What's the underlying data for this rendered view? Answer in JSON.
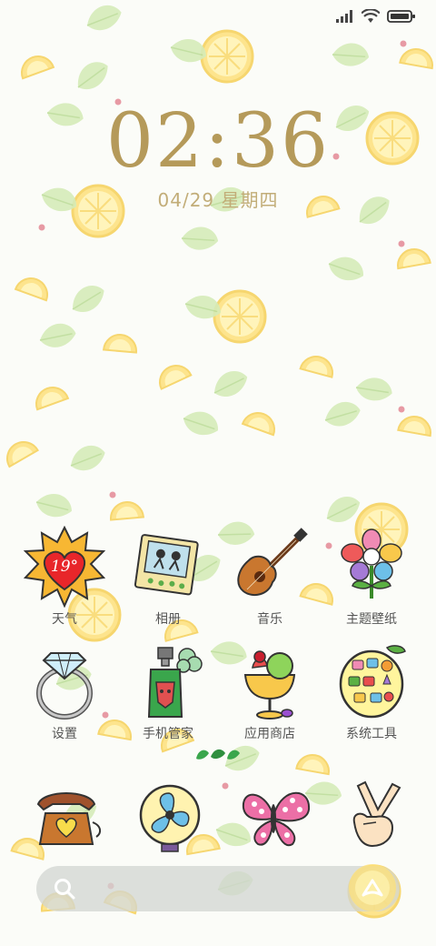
{
  "status_bar": {
    "signal_icon": "signal-bars-icon",
    "wifi_icon": "wifi-icon",
    "battery_icon": "battery-icon"
  },
  "lockscreen": {
    "time": "02:36",
    "date": "04/29 星期四"
  },
  "apps": [
    {
      "label": "天气",
      "icon": "weather-sun-icon",
      "temp": "19°"
    },
    {
      "label": "相册",
      "icon": "photo-album-icon"
    },
    {
      "label": "音乐",
      "icon": "guitar-icon"
    },
    {
      "label": "主题壁纸",
      "icon": "flower-icon"
    },
    {
      "label": "设置",
      "icon": "diamond-ring-icon"
    },
    {
      "label": "手机管家",
      "icon": "perfume-bottle-icon"
    },
    {
      "label": "应用商店",
      "icon": "ice-cream-icon"
    },
    {
      "label": "系统工具",
      "icon": "toolbox-plate-icon"
    }
  ],
  "dock": [
    {
      "name": "phone",
      "icon": "telephone-icon"
    },
    {
      "name": "fan",
      "icon": "fan-icon"
    },
    {
      "name": "butterfly",
      "icon": "butterfly-icon"
    },
    {
      "name": "victory",
      "icon": "victory-hand-icon"
    }
  ],
  "search_bar": {
    "search_icon": "search-icon",
    "assistant_icon": "assistant-icon"
  },
  "colors": {
    "clock": "#b59a5a",
    "lemon": "#fce27a",
    "leaf": "#cfe8b0"
  }
}
